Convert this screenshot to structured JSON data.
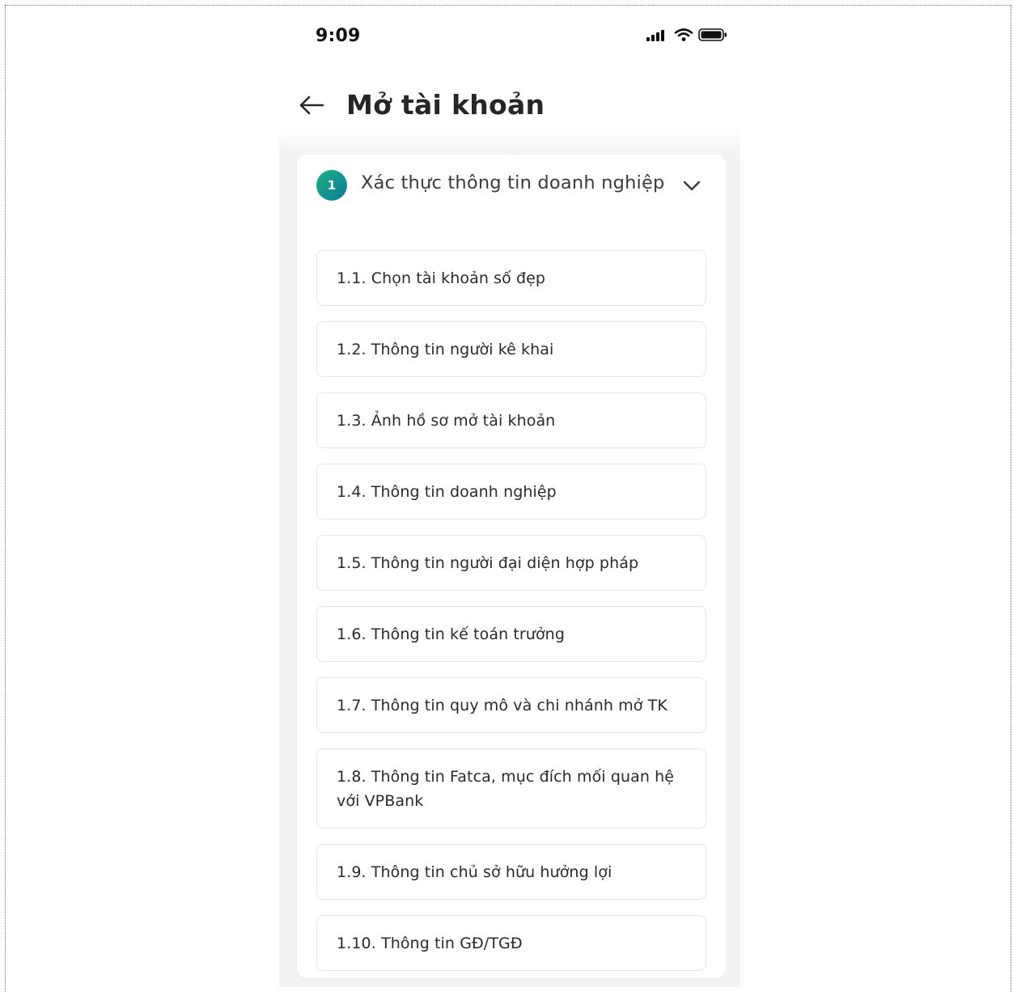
{
  "status_bar": {
    "time": "9:09",
    "icons": [
      "signal-icon",
      "wifi-icon",
      "battery-icon"
    ]
  },
  "header": {
    "back_icon": "arrow-left-icon",
    "title": "Mở tài khoản"
  },
  "step": {
    "number": "1",
    "title": "Xác thực thông tin doanh nghiệp",
    "expanded": true,
    "accent_color": "#1a9a8a"
  },
  "sub_steps": [
    {
      "label": "1.1. Chọn tài khoản số đẹp"
    },
    {
      "label": "1.2. Thông tin người kê khai"
    },
    {
      "label": "1.3. Ảnh hồ sơ mở tài khoản"
    },
    {
      "label": "1.4. Thông tin doanh nghiệp"
    },
    {
      "label": "1.5. Thông tin người đại diện hợp pháp"
    },
    {
      "label": "1.6. Thông tin kế toán trưởng"
    },
    {
      "label": "1.7. Thông tin quy mô và chi nhánh mở TK"
    },
    {
      "label": "1.8. Thông tin Fatca, mục đích mối quan hệ với VPBank"
    },
    {
      "label": "1.9. Thông tin chủ sở hữu hưởng lợi"
    },
    {
      "label": "1.10. Thông tin GĐ/TGĐ"
    }
  ]
}
